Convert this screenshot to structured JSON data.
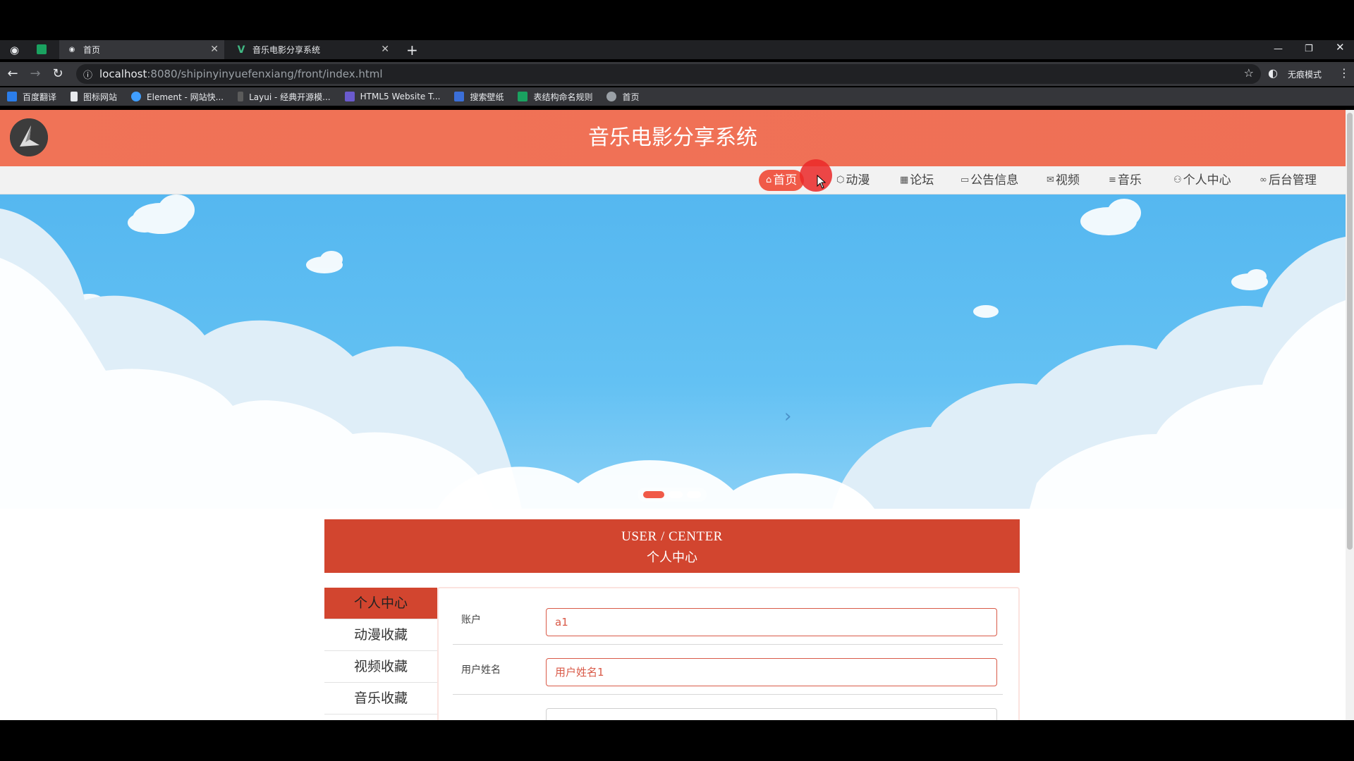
{
  "browser": {
    "tabs": [
      {
        "label": "首页"
      },
      {
        "label": "音乐电影分享系统"
      }
    ],
    "url_host": "localhost",
    "url_path": ":8080/shipinyinyuefenxiang/front/index.html",
    "profile_label": "无痕模式",
    "bookmarks": [
      {
        "label": "百度翻译",
        "color": "#2b7de9"
      },
      {
        "label": "图标网站",
        "color": "#333333"
      },
      {
        "label": "Element - 网站快...",
        "color": "#409eff"
      },
      {
        "label": "Layui - 经典开源模...",
        "color": "#444444"
      },
      {
        "label": "HTML5 Website T...",
        "color": "#6a5acd"
      },
      {
        "label": "搜索壁纸",
        "color": "#3b6fd8"
      },
      {
        "label": "表结构命名规则",
        "color": "#1aa260"
      },
      {
        "label": "首页",
        "color": "#9aa0a6"
      }
    ]
  },
  "header": {
    "title": "音乐电影分享系统"
  },
  "nav": [
    {
      "label": "首页",
      "icon": "home-icon",
      "glyph": "⌂"
    },
    {
      "label": "动漫",
      "icon": "box-icon",
      "glyph": "⬡"
    },
    {
      "label": "论坛",
      "icon": "grid-icon",
      "glyph": "▦"
    },
    {
      "label": "公告信息",
      "icon": "book-icon",
      "glyph": "▭"
    },
    {
      "label": "视频",
      "icon": "mail-icon",
      "glyph": "✉"
    },
    {
      "label": "音乐",
      "icon": "layers-icon",
      "glyph": "≡"
    },
    {
      "label": "个人中心",
      "icon": "user-icon",
      "glyph": "⚇"
    },
    {
      "label": "后台管理",
      "icon": "link-icon",
      "glyph": "∞"
    }
  ],
  "user_center": {
    "title_en": "USER / CENTER",
    "title_zh": "个人中心"
  },
  "sidebar": [
    {
      "label": "个人中心"
    },
    {
      "label": "动漫收藏"
    },
    {
      "label": "视频收藏"
    },
    {
      "label": "音乐收藏"
    }
  ],
  "form": {
    "fields": [
      {
        "label": "账户",
        "value": "a1"
      },
      {
        "label": "用户姓名",
        "value": "用户姓名1"
      }
    ]
  },
  "colors": {
    "header": "#f07357",
    "accent": "#d2452f",
    "nav_active": "#f05a48"
  }
}
